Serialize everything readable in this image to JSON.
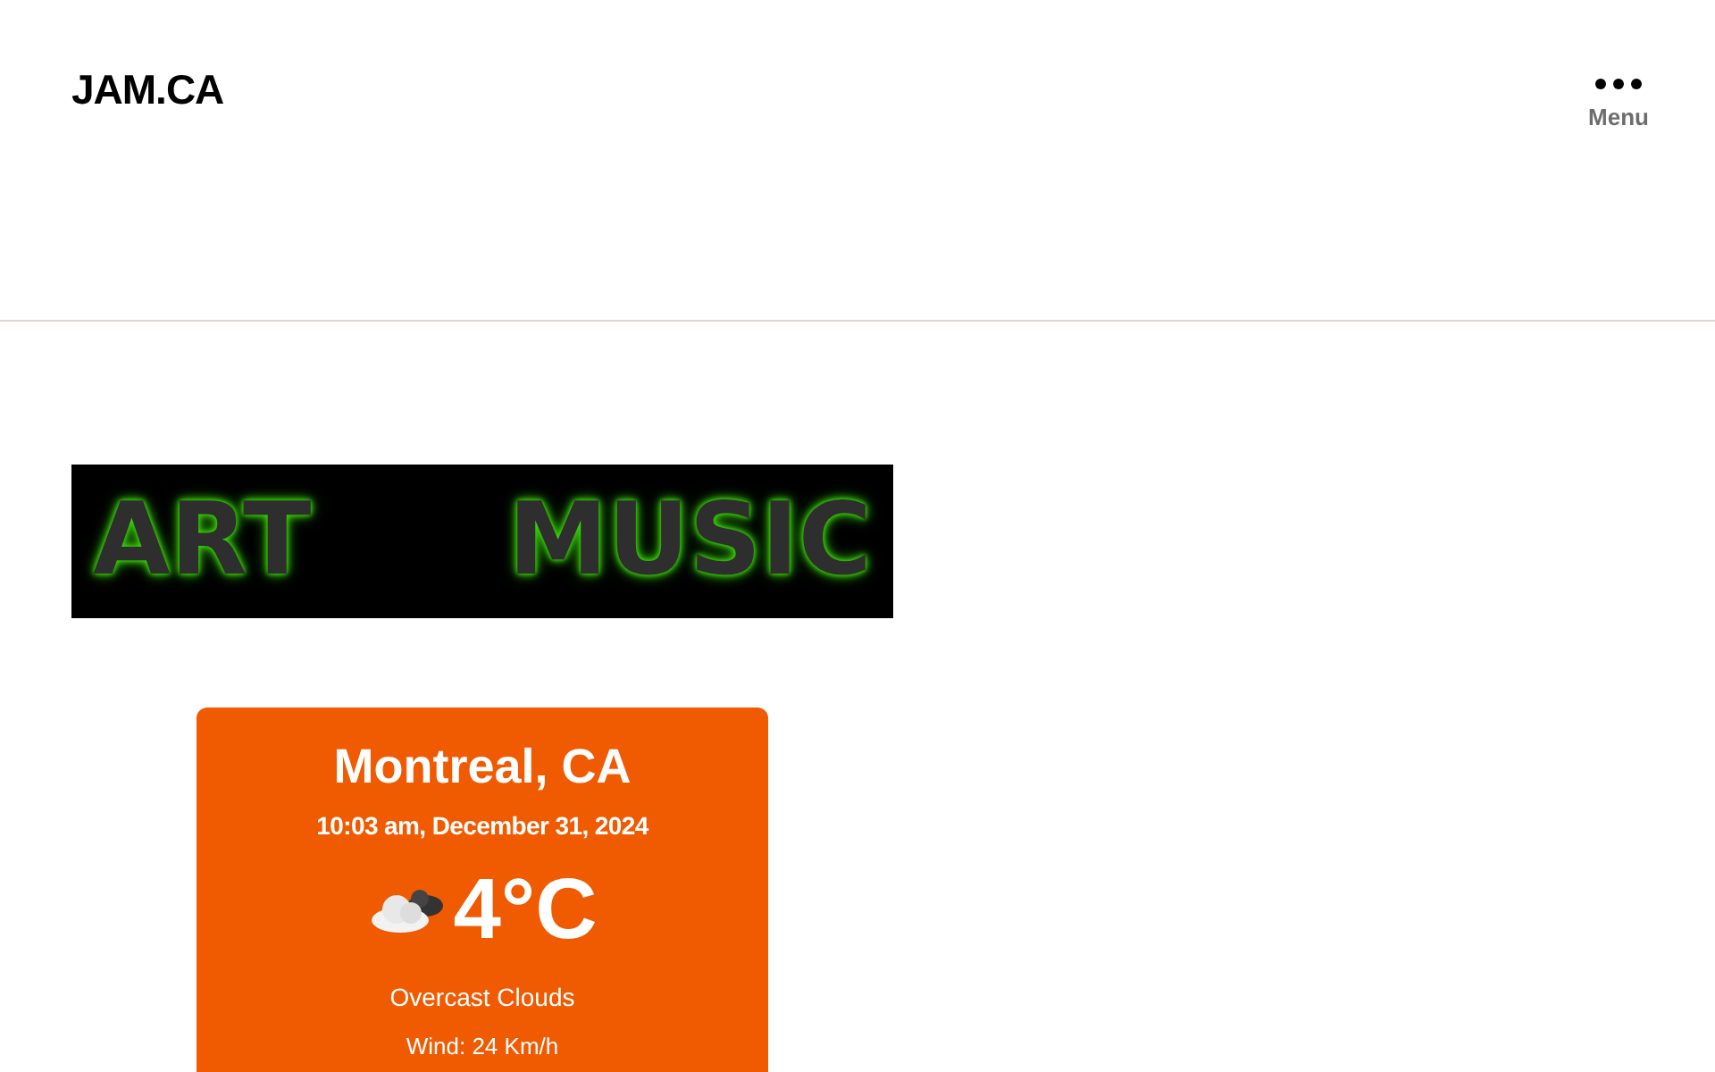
{
  "header": {
    "site_title": "JAM.CA",
    "menu_label": "Menu"
  },
  "banner": {
    "words": [
      "ART",
      "MUSIC"
    ]
  },
  "weather": {
    "city": "Montreal, CA",
    "datetime": "10:03 am, December 31, 2024",
    "temperature": "4°C",
    "condition": "Overcast Clouds",
    "wind": "Wind: 24 Km/h"
  }
}
